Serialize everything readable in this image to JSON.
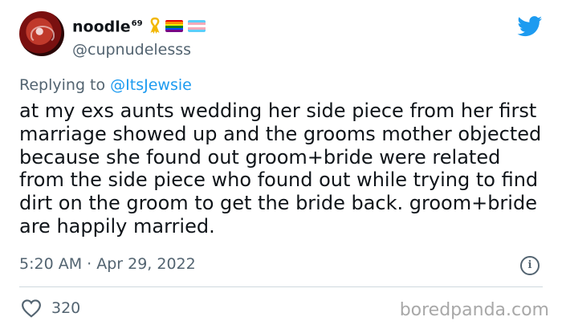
{
  "tweet": {
    "display_name": "noodle",
    "display_name_sup": "69",
    "handle": "@cupnudelesss",
    "reply_prefix": "Replying to",
    "reply_handle": "@ItsJewsie",
    "body": "at my exs aunts wedding her side piece from her first marriage showed up and the grooms mother objected because she found out groom+bride were related from the side piece who found out while trying to find dirt on the groom to get the bride back. groom+bride are happily married.",
    "timestamp": "5:20 AM · Apr 29, 2022",
    "likes": "320"
  },
  "watermark": "boredpanda.com",
  "icons": {
    "ribbon": "awareness-ribbon-icon",
    "flag_rainbow": "rainbow-flag-icon",
    "flag_trans": "trans-flag-icon",
    "brand": "twitter-bird-icon",
    "info": "info-icon",
    "like": "heart-icon"
  },
  "colors": {
    "accent": "#1d9bf0",
    "secondary_text": "#536471",
    "divider": "#cfd9de"
  }
}
